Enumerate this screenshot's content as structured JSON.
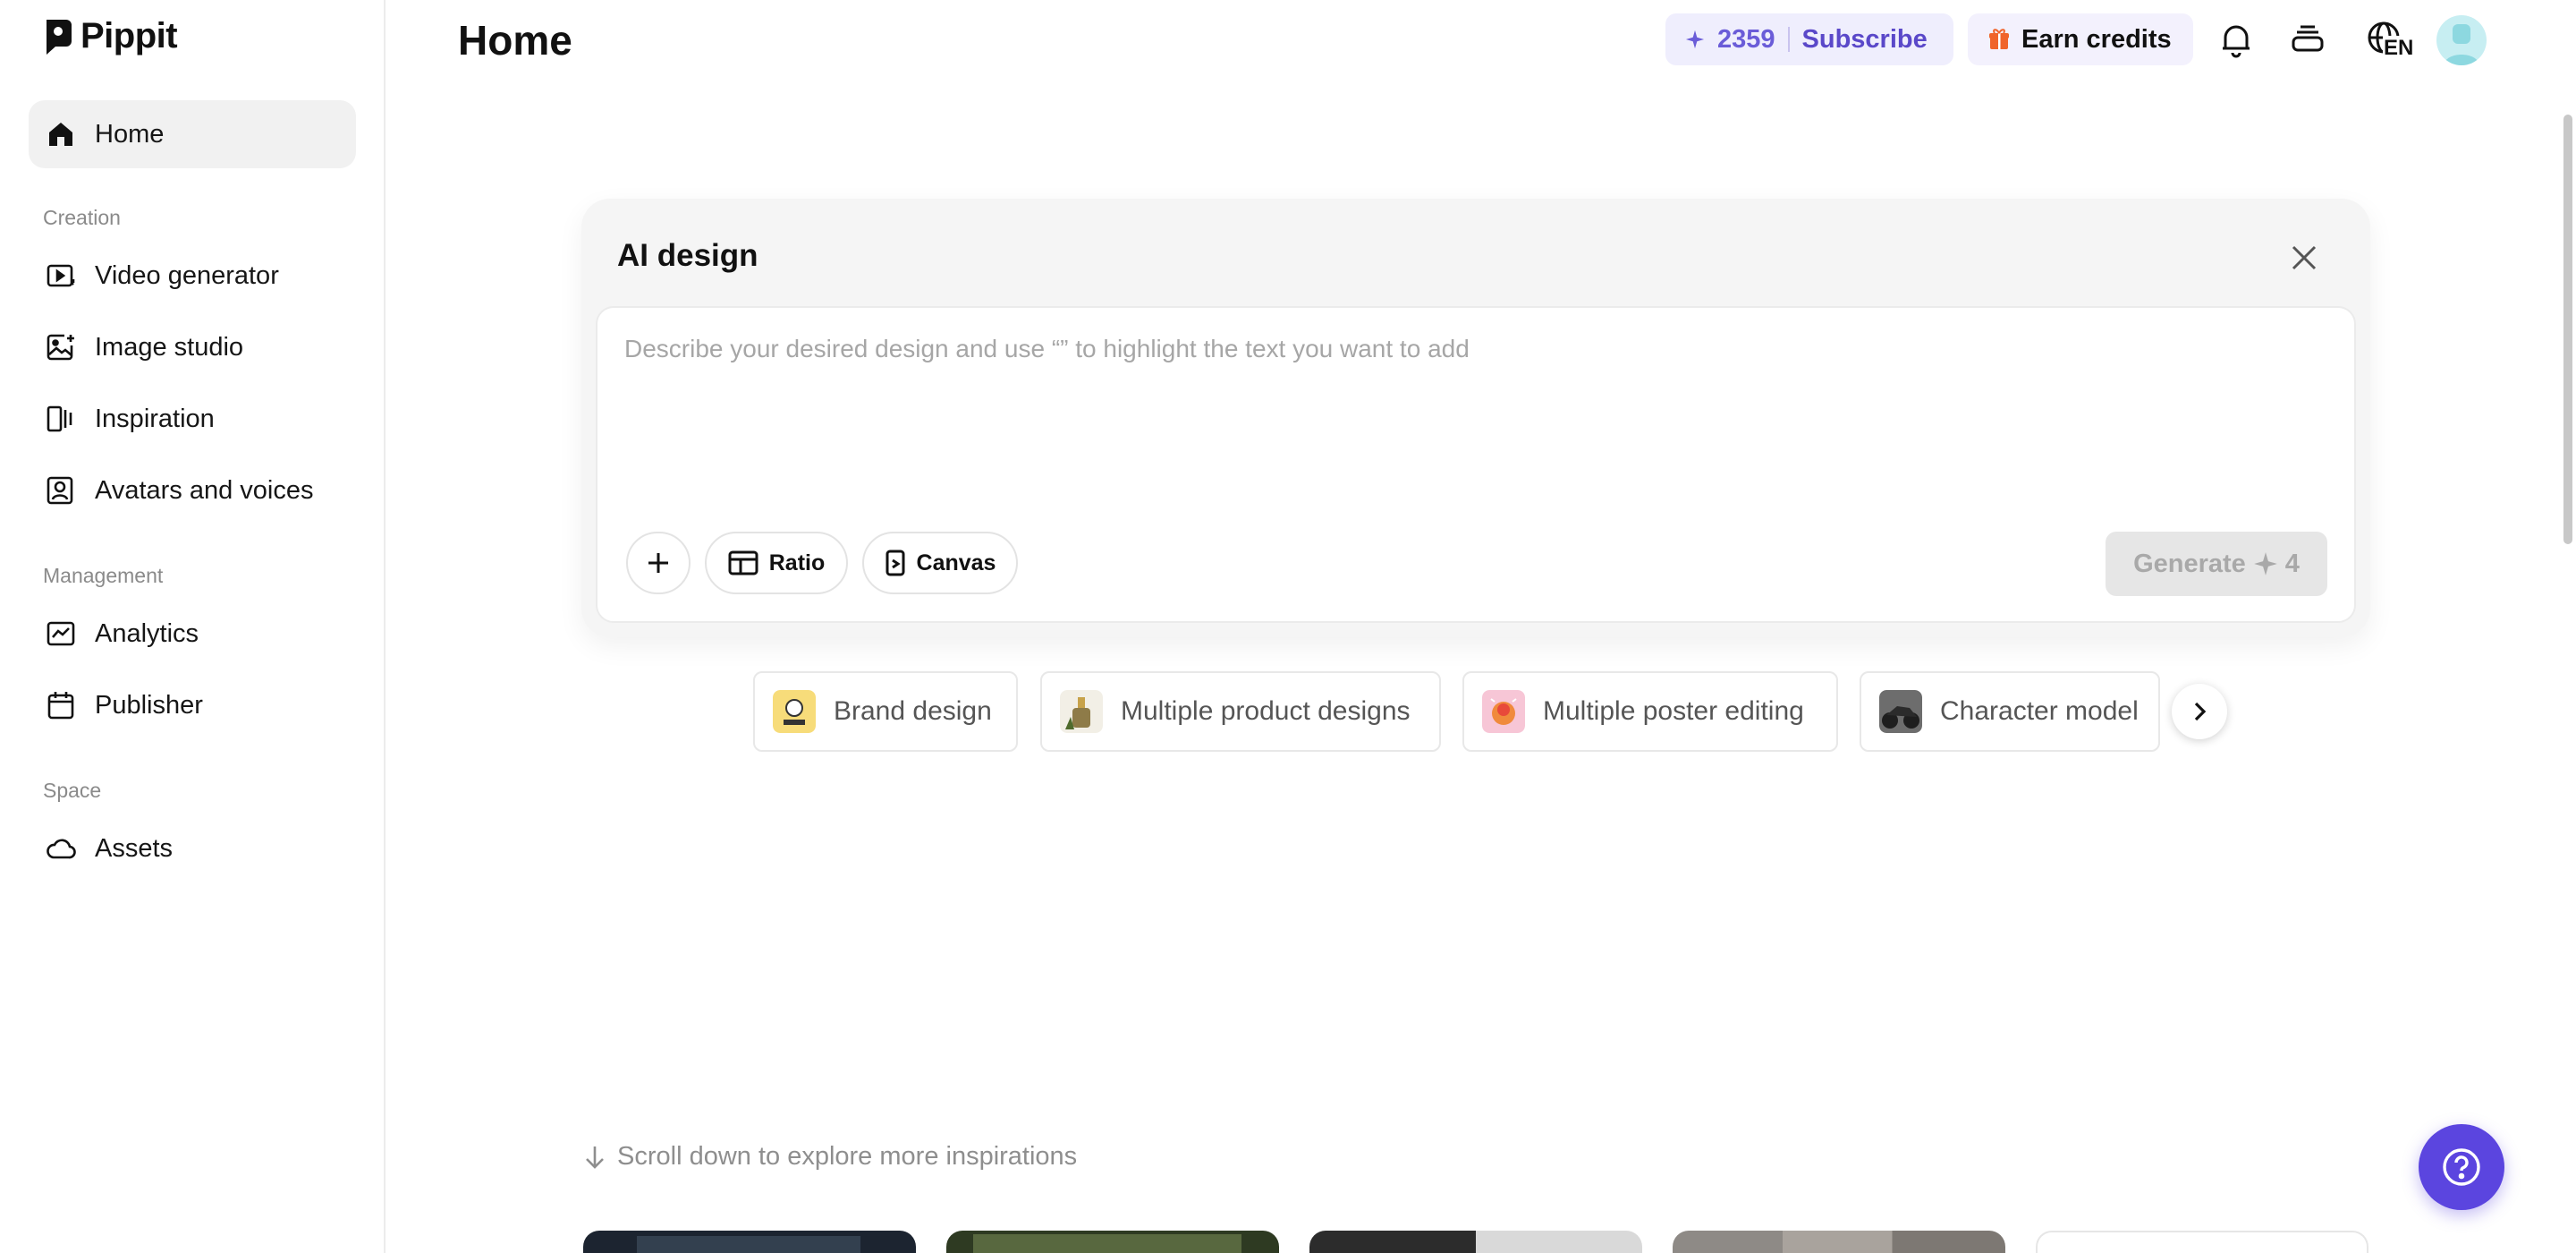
{
  "app": {
    "name": "Pippit"
  },
  "sidebar": {
    "home": "Home",
    "sections": [
      {
        "label": "Creation",
        "items": [
          "Video generator",
          "Image studio",
          "Inspiration",
          "Avatars and voices"
        ]
      },
      {
        "label": "Management",
        "items": [
          "Analytics",
          "Publisher"
        ]
      },
      {
        "label": "Space",
        "items": [
          "Assets"
        ]
      }
    ]
  },
  "header": {
    "title": "Home",
    "credits": "2359",
    "subscribe": "Subscribe",
    "earn_credits": "Earn credits",
    "language": "EN"
  },
  "ai_design": {
    "title": "AI design",
    "placeholder": "Describe your desired design and use “” to highlight the text you want to add",
    "ratio": "Ratio",
    "canvas": "Canvas",
    "generate": "Generate",
    "generate_cost": "4"
  },
  "chips": [
    {
      "label": "Brand design"
    },
    {
      "label": "Multiple product designs"
    },
    {
      "label": "Multiple poster editing"
    },
    {
      "label": "Character model"
    }
  ],
  "scroll_hint": "Scroll down to explore more inspirations",
  "colors": {
    "accent": "#5b45df",
    "credits_text": "#6a5cd8",
    "gift": "#f0642a"
  }
}
